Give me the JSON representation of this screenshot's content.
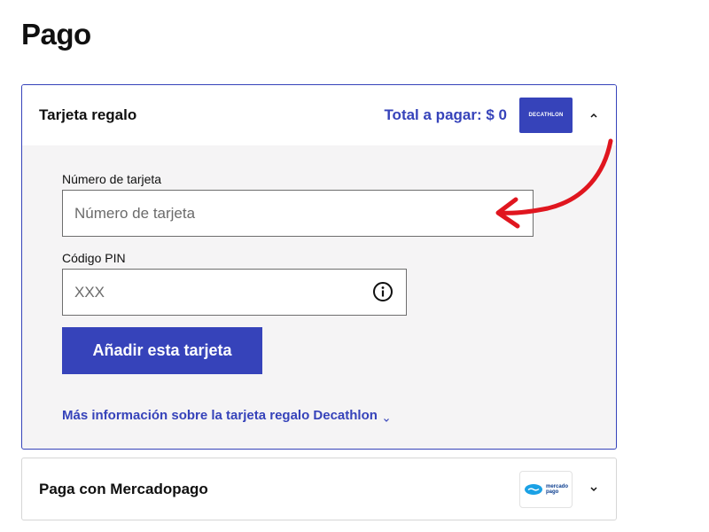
{
  "page": {
    "title": "Pago"
  },
  "gift_card": {
    "title": "Tarjeta regalo",
    "total": "Total a pagar: $ 0",
    "logo_text": "DECATHLON",
    "card_number": {
      "label": "Número de tarjeta",
      "placeholder": "Número de tarjeta",
      "value": ""
    },
    "pin": {
      "label": "Código PIN",
      "placeholder": "XXX",
      "value": ""
    },
    "add_button": "Añadir esta tarjeta",
    "more_info": "Más información sobre la tarjeta regalo Decathlon",
    "expanded": true
  },
  "mercadopago": {
    "title": "Paga con Mercadopago",
    "logo_text_top": "mercado",
    "logo_text_bottom": "pago",
    "expanded": false
  },
  "colors": {
    "brand": "#3643ba",
    "panel_bg": "#f5f4f5",
    "annotation": "#e0161f"
  },
  "icons": [
    "chevron-up-icon",
    "info-icon",
    "chevron-down-icon",
    "decathlon-logo",
    "mercadopago-logo"
  ]
}
